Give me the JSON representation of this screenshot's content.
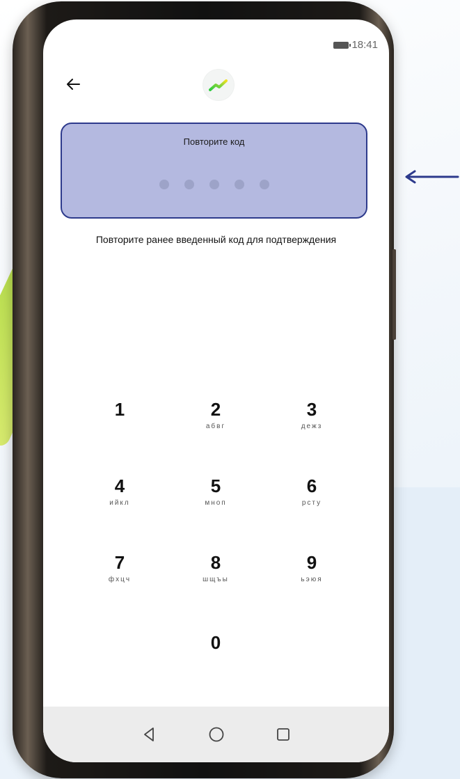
{
  "status_bar": {
    "time": "18:41",
    "battery_icon": "battery-icon"
  },
  "header": {
    "back_icon": "arrow-left-icon",
    "logo_icon": "chart-trend-logo-icon"
  },
  "code_panel": {
    "title": "Повторите код",
    "dot_count": 5,
    "filled_count": 0
  },
  "hint": "Повторите ранее введенный код для подтверждения",
  "keypad": {
    "k1": {
      "digit": "1",
      "letters": ""
    },
    "k2": {
      "digit": "2",
      "letters": "абвг"
    },
    "k3": {
      "digit": "3",
      "letters": "дежз"
    },
    "k4": {
      "digit": "4",
      "letters": "ийкл"
    },
    "k5": {
      "digit": "5",
      "letters": "мноп"
    },
    "k6": {
      "digit": "6",
      "letters": "рсту"
    },
    "k7": {
      "digit": "7",
      "letters": "фхцч"
    },
    "k8": {
      "digit": "8",
      "letters": "шщъы"
    },
    "k9": {
      "digit": "9",
      "letters": "ьэюя"
    },
    "k0": {
      "digit": "0",
      "letters": ""
    }
  },
  "nav_bar": {
    "back_icon": "triangle-back-icon",
    "home_icon": "circle-home-icon",
    "recents_icon": "square-recents-icon"
  },
  "colors": {
    "panel_bg": "#b4b9e0",
    "panel_border": "#2d3a8c",
    "arrow": "#2d3a8c",
    "logo_green": "#2ecc40",
    "logo_yellow": "#f0e020"
  }
}
